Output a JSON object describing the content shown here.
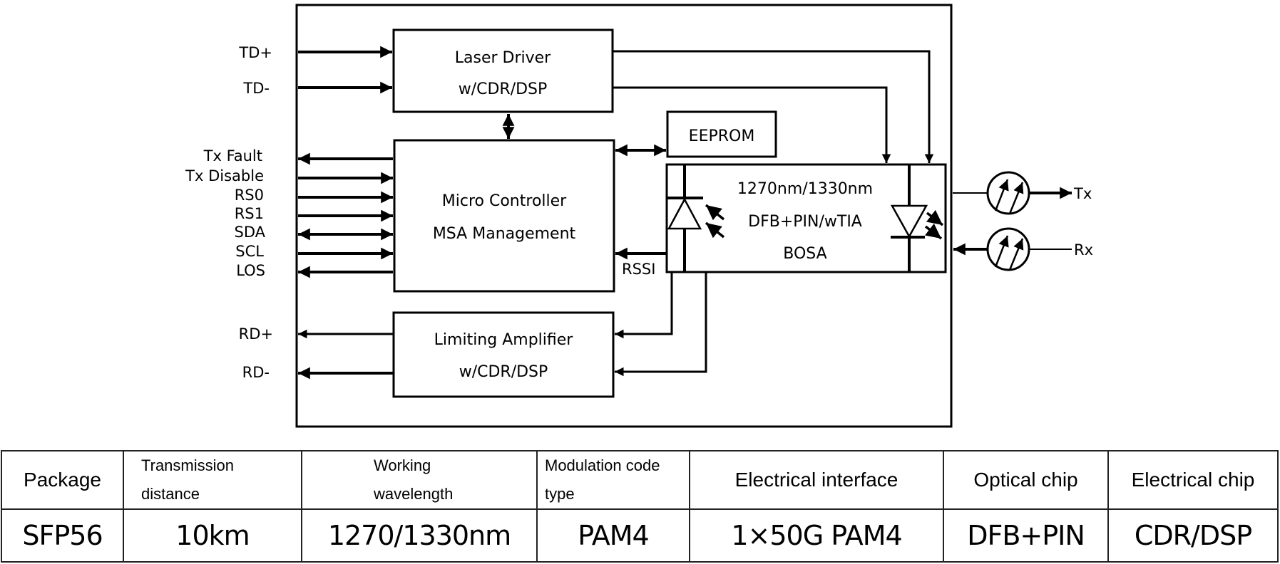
{
  "diagram": {
    "blocks": {
      "laser_driver": [
        "Laser Driver",
        "w/CDR/DSP"
      ],
      "micro_controller": [
        "Micro Controller",
        "MSA Management"
      ],
      "eeprom": [
        "EEPROM"
      ],
      "limiting_amplifier": [
        "Limiting Amplifier",
        "w/CDR/DSP"
      ],
      "bosa": [
        "1270nm/1330nm",
        "DFB+PIN/wTIA",
        "BOSA"
      ]
    },
    "signals_left": {
      "td_plus": "TD+",
      "td_minus": "TD-",
      "tx_fault": "Tx Fault",
      "tx_disable": "Tx Disable",
      "rs0": "RS0",
      "rs1": "RS1",
      "sda": "SDA",
      "scl": "SCL",
      "los": "LOS",
      "rd_plus": "RD+",
      "rd_minus": "RD-"
    },
    "rssi": "RSSI",
    "optical": {
      "tx": "Tx",
      "rx": "Rx"
    }
  },
  "table": {
    "headers": [
      "Package",
      [
        "Transmission",
        "distance"
      ],
      [
        "Working",
        "wavelength"
      ],
      [
        "Modulation code",
        "type"
      ],
      "Electrical interface",
      "Optical chip",
      "Electrical chip"
    ],
    "row": [
      "SFP56",
      "10km",
      "1270/1330nm",
      "PAM4",
      "1×50G PAM4",
      "DFB+PIN",
      "CDR/DSP"
    ]
  }
}
